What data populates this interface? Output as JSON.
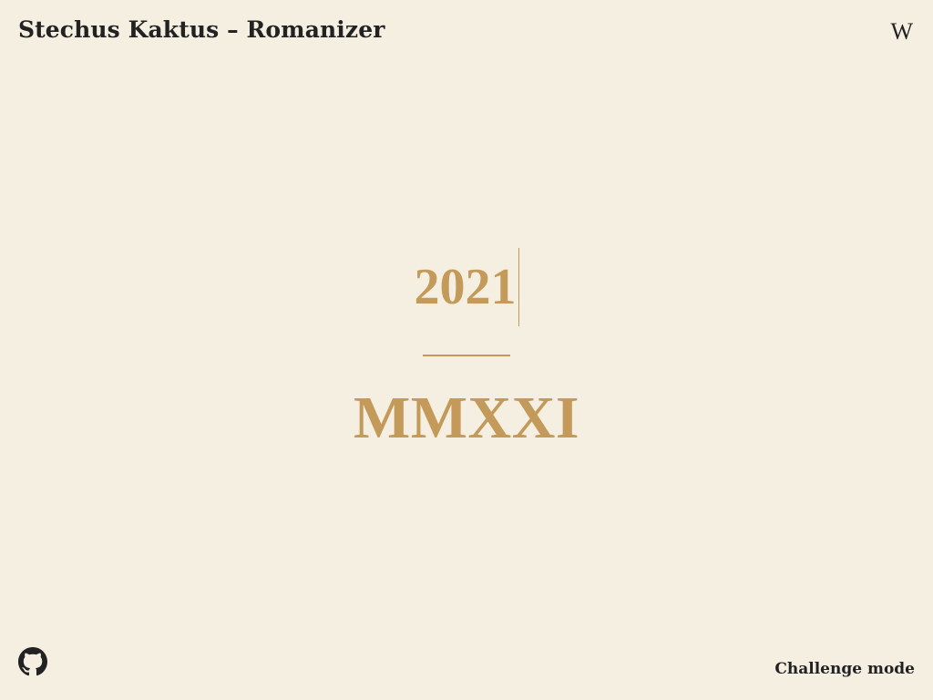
{
  "header": {
    "title": "Stechus Kaktus – Romanizer",
    "wikipedia_label": "W"
  },
  "main": {
    "input_value": "2021",
    "roman_value": "MMXXI"
  },
  "footer": {
    "github_icon": "github-icon",
    "challenge_label": "Challenge mode"
  },
  "colors": {
    "background": "#f5efe2",
    "accent": "#c49a5a",
    "text": "#222222"
  }
}
